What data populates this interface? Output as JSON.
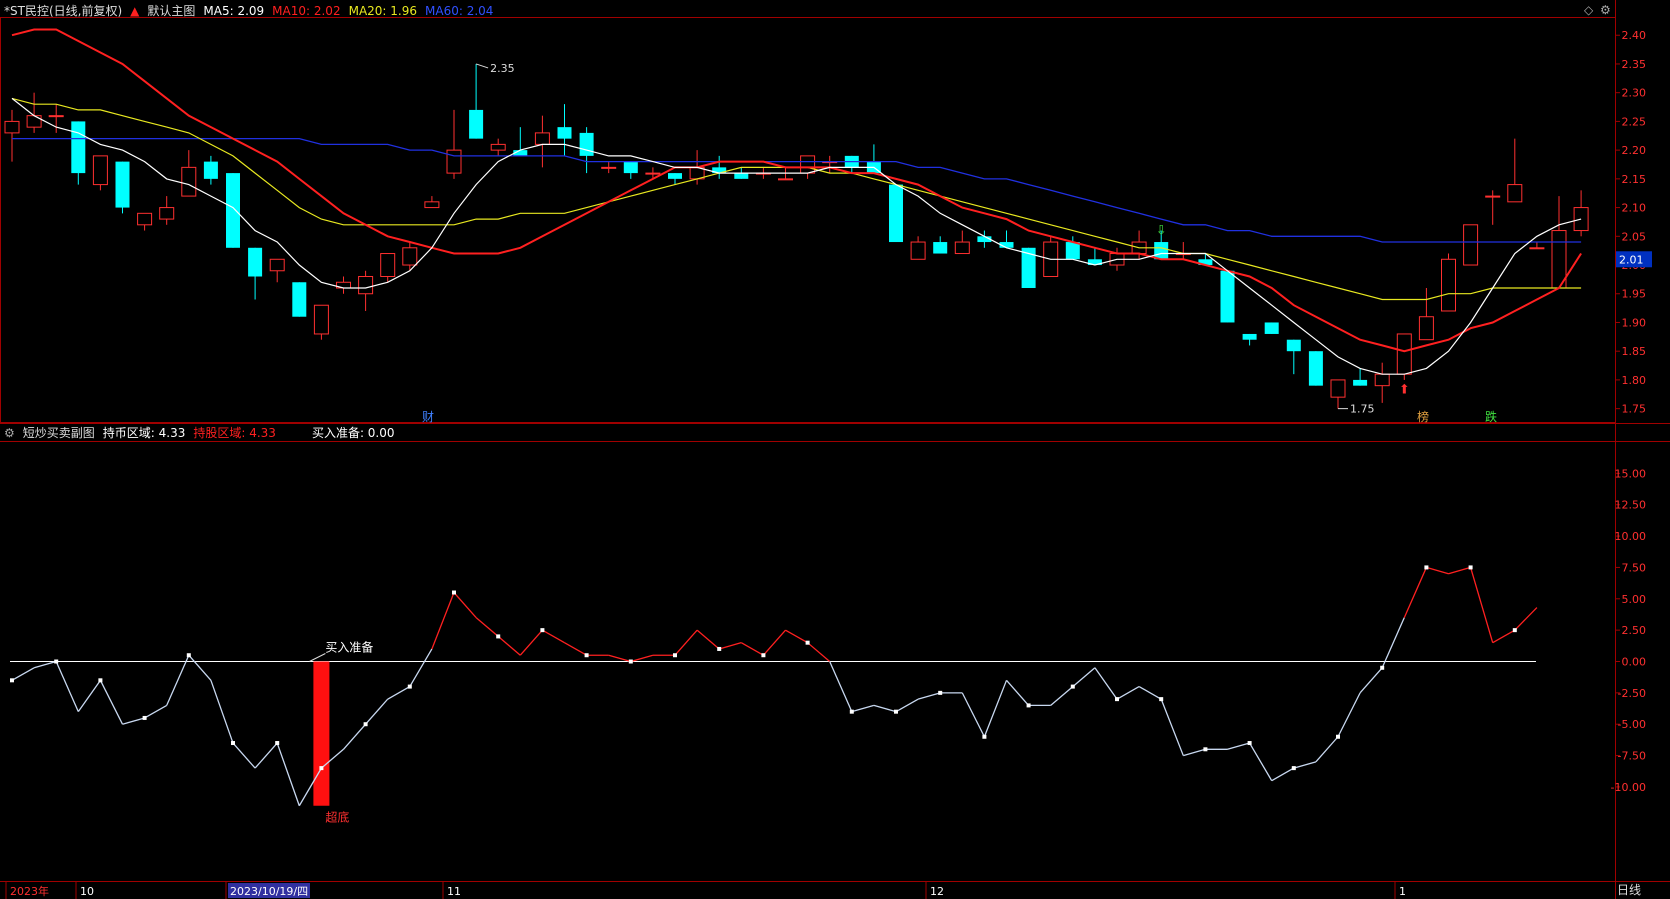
{
  "main_panel": {
    "stock_name": "*ST民控(日线,前复权)",
    "up_arrow_icon": "red-up-arrow-icon",
    "indicator_name": "默认主图",
    "ma_labels": [
      {
        "text": "MA5: 2.09",
        "color": "#ffffff"
      },
      {
        "text": "MA10: 2.02",
        "color": "#ff2020"
      },
      {
        "text": "MA20: 1.96",
        "color": "#e8e820"
      },
      {
        "text": "MA60: 2.04",
        "color": "#2040ff"
      }
    ],
    "current_price_label": "2.01",
    "high_annotation": "2.35",
    "low_annotation": "1.75",
    "markers": [
      {
        "text": "财",
        "color": "#4080ff"
      },
      {
        "text": "榜",
        "color": "#e0a040"
      },
      {
        "text": "跌",
        "color": "#40e040"
      }
    ]
  },
  "sub_panel": {
    "indicator_name": "短炒买卖副图",
    "labels": [
      {
        "text": "持币区域: 4.33",
        "color": "#ffffff"
      },
      {
        "text": "持股区域: 4.33",
        "color": "#ff2020"
      },
      {
        "text": "买入准备: 0.00",
        "color": "#ffffff"
      }
    ],
    "buy_ready_label": "买入准备",
    "bottom_label": "超底"
  },
  "time_axis": {
    "labels": [
      "2023年",
      "10",
      "2023/10/19/四",
      "11",
      "12",
      "1"
    ],
    "period": "日线"
  },
  "colors": {
    "up": "#ff3030",
    "down": "#00ffff",
    "ma5": "#ffffff",
    "ma10": "#ff2020",
    "ma20": "#e8e820",
    "ma60": "#2030e0",
    "frame": "#a00000"
  },
  "chart_data": [
    {
      "type": "candlestick",
      "y_axis_ticks": [
        2.4,
        2.35,
        2.3,
        2.25,
        2.2,
        2.15,
        2.1,
        2.05,
        2.0,
        1.95,
        1.9,
        1.85,
        1.8,
        1.75
      ],
      "ylim": [
        1.725,
        2.43
      ],
      "ohlc": [
        [
          2.23,
          2.27,
          2.18,
          2.25
        ],
        [
          2.24,
          2.3,
          2.23,
          2.26
        ],
        [
          2.26,
          2.28,
          2.23,
          2.26
        ],
        [
          2.25,
          2.25,
          2.14,
          2.16
        ],
        [
          2.14,
          2.18,
          2.13,
          2.19
        ],
        [
          2.18,
          2.18,
          2.09,
          2.1
        ],
        [
          2.07,
          2.09,
          2.06,
          2.09
        ],
        [
          2.08,
          2.12,
          2.07,
          2.1
        ],
        [
          2.12,
          2.2,
          2.12,
          2.17
        ],
        [
          2.18,
          2.19,
          2.14,
          2.15
        ],
        [
          2.16,
          2.16,
          2.03,
          2.03
        ],
        [
          2.03,
          2.03,
          1.94,
          1.98
        ],
        [
          1.99,
          2.01,
          1.97,
          2.01
        ],
        [
          1.97,
          1.97,
          1.91,
          1.91
        ],
        [
          1.88,
          1.88,
          1.87,
          1.93
        ],
        [
          1.96,
          1.98,
          1.95,
          1.97
        ],
        [
          1.95,
          1.99,
          1.92,
          1.98
        ],
        [
          1.98,
          2.02,
          1.97,
          2.02
        ],
        [
          2.0,
          2.04,
          1.99,
          2.03
        ],
        [
          2.1,
          2.12,
          2.1,
          2.11
        ],
        [
          2.16,
          2.27,
          2.15,
          2.2
        ],
        [
          2.27,
          2.35,
          2.22,
          2.22
        ],
        [
          2.2,
          2.22,
          2.19,
          2.21
        ],
        [
          2.2,
          2.24,
          2.19,
          2.19
        ],
        [
          2.21,
          2.26,
          2.17,
          2.23
        ],
        [
          2.24,
          2.28,
          2.19,
          2.22
        ],
        [
          2.23,
          2.24,
          2.16,
          2.19
        ],
        [
          2.17,
          2.18,
          2.16,
          2.17
        ],
        [
          2.18,
          2.18,
          2.15,
          2.16
        ],
        [
          2.16,
          2.17,
          2.15,
          2.16
        ],
        [
          2.16,
          2.16,
          2.14,
          2.15
        ],
        [
          2.15,
          2.2,
          2.14,
          2.17
        ],
        [
          2.17,
          2.19,
          2.15,
          2.16
        ],
        [
          2.16,
          2.17,
          2.15,
          2.15
        ],
        [
          2.16,
          2.17,
          2.15,
          2.16
        ],
        [
          2.15,
          2.17,
          2.15,
          2.15
        ],
        [
          2.16,
          2.19,
          2.15,
          2.19
        ],
        [
          2.18,
          2.19,
          2.16,
          2.18
        ],
        [
          2.19,
          2.19,
          2.16,
          2.17
        ],
        [
          2.18,
          2.21,
          2.16,
          2.16
        ],
        [
          2.14,
          2.14,
          2.04,
          2.04
        ],
        [
          2.01,
          2.05,
          2.01,
          2.04
        ],
        [
          2.04,
          2.05,
          2.02,
          2.02
        ],
        [
          2.02,
          2.06,
          2.02,
          2.04
        ],
        [
          2.05,
          2.06,
          2.03,
          2.04
        ],
        [
          2.04,
          2.06,
          2.03,
          2.03
        ],
        [
          2.03,
          2.03,
          1.96,
          1.96
        ],
        [
          1.98,
          2.05,
          1.98,
          2.04
        ],
        [
          2.04,
          2.05,
          2.01,
          2.01
        ],
        [
          2.01,
          2.03,
          2.0,
          2.0
        ],
        [
          2.0,
          2.03,
          1.99,
          2.02
        ],
        [
          2.02,
          2.06,
          2.01,
          2.04
        ],
        [
          2.04,
          2.06,
          2.01,
          2.01
        ],
        [
          2.02,
          2.04,
          2.01,
          2.02
        ],
        [
          2.01,
          2.02,
          2.0,
          2.0
        ],
        [
          1.99,
          1.99,
          1.9,
          1.9
        ],
        [
          1.88,
          1.88,
          1.86,
          1.87
        ],
        [
          1.9,
          1.9,
          1.88,
          1.88
        ],
        [
          1.87,
          1.87,
          1.81,
          1.85
        ],
        [
          1.85,
          1.85,
          1.79,
          1.79
        ],
        [
          1.77,
          1.8,
          1.75,
          1.8
        ],
        [
          1.8,
          1.82,
          1.79,
          1.79
        ],
        [
          1.79,
          1.83,
          1.76,
          1.81
        ],
        [
          1.81,
          1.88,
          1.8,
          1.88
        ],
        [
          1.87,
          1.96,
          1.87,
          1.91
        ],
        [
          1.92,
          2.02,
          1.92,
          2.01
        ],
        [
          2.0,
          2.07,
          2.0,
          2.07
        ],
        [
          2.12,
          2.13,
          2.07,
          2.12
        ],
        [
          2.11,
          2.22,
          2.11,
          2.14
        ],
        [
          2.03,
          2.04,
          2.03,
          2.03
        ],
        [
          1.96,
          2.12,
          1.96,
          2.06
        ],
        [
          2.06,
          2.13,
          2.05,
          2.1
        ]
      ],
      "ma5": [
        2.29,
        2.26,
        2.24,
        2.23,
        2.21,
        2.2,
        2.18,
        2.15,
        2.14,
        2.12,
        2.1,
        2.06,
        2.04,
        2.0,
        1.97,
        1.96,
        1.96,
        1.97,
        1.99,
        2.03,
        2.09,
        2.14,
        2.18,
        2.2,
        2.21,
        2.21,
        2.2,
        2.19,
        2.19,
        2.18,
        2.17,
        2.17,
        2.16,
        2.16,
        2.16,
        2.16,
        2.16,
        2.17,
        2.17,
        2.17,
        2.14,
        2.12,
        2.09,
        2.07,
        2.05,
        2.03,
        2.02,
        2.01,
        2.01,
        2.0,
        2.01,
        2.01,
        2.02,
        2.02,
        2.02,
        1.99,
        1.96,
        1.93,
        1.9,
        1.87,
        1.84,
        1.82,
        1.81,
        1.81,
        1.82,
        1.85,
        1.9,
        1.96,
        2.02,
        2.05,
        2.07,
        2.08
      ],
      "ma10": [
        2.4,
        2.41,
        2.41,
        2.39,
        2.37,
        2.35,
        2.32,
        2.29,
        2.26,
        2.24,
        2.22,
        2.2,
        2.18,
        2.15,
        2.12,
        2.09,
        2.07,
        2.05,
        2.04,
        2.03,
        2.02,
        2.02,
        2.02,
        2.03,
        2.05,
        2.07,
        2.09,
        2.11,
        2.13,
        2.15,
        2.17,
        2.17,
        2.18,
        2.18,
        2.18,
        2.17,
        2.17,
        2.17,
        2.16,
        2.16,
        2.15,
        2.14,
        2.12,
        2.1,
        2.09,
        2.08,
        2.06,
        2.05,
        2.04,
        2.03,
        2.02,
        2.02,
        2.01,
        2.01,
        2.0,
        1.99,
        1.98,
        1.96,
        1.93,
        1.91,
        1.89,
        1.87,
        1.86,
        1.85,
        1.86,
        1.87,
        1.89,
        1.9,
        1.92,
        1.94,
        1.96,
        2.02
      ],
      "ma20": [
        2.29,
        2.28,
        2.28,
        2.27,
        2.27,
        2.26,
        2.25,
        2.24,
        2.23,
        2.21,
        2.19,
        2.16,
        2.13,
        2.1,
        2.08,
        2.07,
        2.07,
        2.07,
        2.07,
        2.07,
        2.07,
        2.08,
        2.08,
        2.09,
        2.09,
        2.09,
        2.1,
        2.11,
        2.12,
        2.13,
        2.14,
        2.15,
        2.16,
        2.17,
        2.17,
        2.17,
        2.17,
        2.16,
        2.16,
        2.15,
        2.14,
        2.13,
        2.12,
        2.11,
        2.1,
        2.09,
        2.08,
        2.07,
        2.06,
        2.05,
        2.04,
        2.03,
        2.03,
        2.02,
        2.02,
        2.01,
        2.0,
        1.99,
        1.98,
        1.97,
        1.96,
        1.95,
        1.94,
        1.94,
        1.94,
        1.95,
        1.95,
        1.96,
        1.96,
        1.96,
        1.96,
        1.96
      ],
      "ma60": [
        2.22,
        2.22,
        2.22,
        2.22,
        2.22,
        2.22,
        2.22,
        2.22,
        2.22,
        2.22,
        2.22,
        2.22,
        2.22,
        2.22,
        2.21,
        2.21,
        2.21,
        2.21,
        2.2,
        2.2,
        2.19,
        2.19,
        2.19,
        2.19,
        2.19,
        2.19,
        2.18,
        2.18,
        2.18,
        2.18,
        2.18,
        2.18,
        2.18,
        2.18,
        2.18,
        2.18,
        2.18,
        2.18,
        2.18,
        2.18,
        2.18,
        2.17,
        2.17,
        2.16,
        2.15,
        2.15,
        2.14,
        2.13,
        2.12,
        2.11,
        2.1,
        2.09,
        2.08,
        2.07,
        2.07,
        2.06,
        2.06,
        2.05,
        2.05,
        2.05,
        2.05,
        2.05,
        2.04,
        2.04,
        2.04,
        2.04,
        2.04,
        2.04,
        2.04,
        2.04,
        2.04,
        2.04
      ]
    },
    {
      "type": "line",
      "y_axis_ticks": [
        15.0,
        12.5,
        10.0,
        7.5,
        5.0,
        2.5,
        0.0,
        -2.5,
        -5.0,
        -7.5,
        -10.0
      ],
      "ylim": [
        -17.5,
        17.5
      ],
      "values": [
        -1.5,
        -0.5,
        0.0,
        -4.0,
        -1.5,
        -5.0,
        -4.5,
        -3.5,
        0.5,
        -1.5,
        -6.5,
        -8.5,
        -6.5,
        -11.5,
        -8.5,
        -7.0,
        -5.0,
        -3.0,
        -2.0,
        1.0,
        5.5,
        3.5,
        2.0,
        0.5,
        2.5,
        1.5,
        0.5,
        0.5,
        0.0,
        0.5,
        0.5,
        2.5,
        1.0,
        1.5,
        0.5,
        2.5,
        1.5,
        0.0,
        -4.0,
        -3.5,
        -4.0,
        -3.0,
        -2.5,
        -2.5,
        -6.0,
        -1.5,
        -3.5,
        -3.5,
        -2.0,
        -0.5,
        -3.0,
        -2.0,
        -3.0,
        -7.5,
        -7.0,
        -7.0,
        -6.5,
        -9.5,
        -8.5,
        -8.0,
        -6.0,
        -2.5,
        -0.5,
        3.5,
        7.5,
        7.0,
        7.5,
        1.5,
        2.5,
        4.3
      ],
      "bar": {
        "index": 14,
        "from": 0.0,
        "to": -11.5,
        "label": "超底"
      },
      "zero_line": 0.0
    }
  ]
}
